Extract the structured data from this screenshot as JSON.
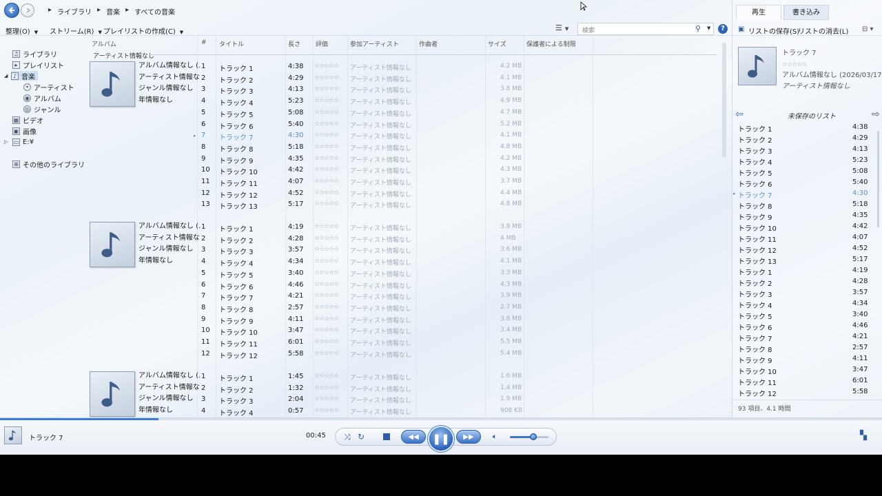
{
  "breadcrumb": [
    "ライブラリ",
    "音楽",
    "すべての音楽"
  ],
  "menu": {
    "organize": "整理(O)",
    "stream": "ストリーム(R)",
    "create_playlist": "プレイリストの作成(C)"
  },
  "search": {
    "placeholder": "検索"
  },
  "nav": {
    "library": "ライブラリ",
    "playlist": "プレイリスト",
    "music": "音楽",
    "artist": "アーティスト",
    "album": "アルバム",
    "genre": "ジャンル",
    "video": "ビデオ",
    "pictures": "画像",
    "drive": "E:¥",
    "other_libraries": "その他のライブラリ"
  },
  "columns": {
    "album": "アルバム",
    "num": "#",
    "title": "タイトル",
    "length": "長さ",
    "rating": "評価",
    "contributing_artist": "参加アーティスト",
    "composer": "作曲者",
    "size": "サイズ",
    "parental_rating": "保護者による制限"
  },
  "group_label": "アーティスト情報なし",
  "rating_stars": "☆☆☆☆☆",
  "artist_unknown": "アーティスト情報なし",
  "albums": [
    {
      "info": [
        "アルバム情報なし (...",
        "アーティスト情報なし",
        "ジャンル情報なし",
        "年情報なし"
      ],
      "tracks": [
        {
          "num": "1",
          "title": "トラック 1",
          "length": "4:38",
          "size": "4.2 MB"
        },
        {
          "num": "2",
          "title": "トラック 2",
          "length": "4:29",
          "size": "4.1 MB"
        },
        {
          "num": "3",
          "title": "トラック 3",
          "length": "4:13",
          "size": "3.8 MB"
        },
        {
          "num": "4",
          "title": "トラック 4",
          "length": "5:23",
          "size": "4.9 MB"
        },
        {
          "num": "5",
          "title": "トラック 5",
          "length": "5:08",
          "size": "4.7 MB"
        },
        {
          "num": "6",
          "title": "トラック 6",
          "length": "5:40",
          "size": "5.2 MB"
        },
        {
          "num": "7",
          "title": "トラック 7",
          "length": "4:30",
          "size": "4.1 MB",
          "playing": true
        },
        {
          "num": "8",
          "title": "トラック 8",
          "length": "5:18",
          "size": "4.8 MB"
        },
        {
          "num": "9",
          "title": "トラック 9",
          "length": "4:35",
          "size": "4.2 MB"
        },
        {
          "num": "10",
          "title": "トラック 10",
          "length": "4:42",
          "size": "4.3 MB"
        },
        {
          "num": "11",
          "title": "トラック 11",
          "length": "4:07",
          "size": "3.7 MB"
        },
        {
          "num": "12",
          "title": "トラック 12",
          "length": "4:52",
          "size": "4.4 MB"
        },
        {
          "num": "13",
          "title": "トラック 13",
          "length": "5:17",
          "size": "4.8 MB"
        }
      ]
    },
    {
      "info": [
        "アルバム情報なし (...",
        "アーティスト情報なし",
        "ジャンル情報なし",
        "年情報なし"
      ],
      "tracks": [
        {
          "num": "1",
          "title": "トラック 1",
          "length": "4:19",
          "size": "3.9 MB"
        },
        {
          "num": "2",
          "title": "トラック 2",
          "length": "4:28",
          "size": "4 MB"
        },
        {
          "num": "3",
          "title": "トラック 3",
          "length": "3:57",
          "size": "3.6 MB"
        },
        {
          "num": "4",
          "title": "トラック 4",
          "length": "4:34",
          "size": "4.1 MB"
        },
        {
          "num": "5",
          "title": "トラック 5",
          "length": "3:40",
          "size": "3.3 MB"
        },
        {
          "num": "6",
          "title": "トラック 6",
          "length": "4:46",
          "size": "4.3 MB"
        },
        {
          "num": "7",
          "title": "トラック 7",
          "length": "4:21",
          "size": "3.9 MB"
        },
        {
          "num": "8",
          "title": "トラック 8",
          "length": "2:57",
          "size": "2.7 MB"
        },
        {
          "num": "9",
          "title": "トラック 9",
          "length": "4:11",
          "size": "3.8 MB"
        },
        {
          "num": "10",
          "title": "トラック 10",
          "length": "3:47",
          "size": "3.4 MB"
        },
        {
          "num": "11",
          "title": "トラック 11",
          "length": "6:01",
          "size": "5.5 MB"
        },
        {
          "num": "12",
          "title": "トラック 12",
          "length": "5:58",
          "size": "5.4 MB"
        }
      ]
    },
    {
      "info": [
        "アルバム情報なし (...",
        "アーティスト情報なし",
        "ジャンル情報なし",
        "年情報なし"
      ],
      "tracks": [
        {
          "num": "1",
          "title": "トラック 1",
          "length": "1:45",
          "size": "1.6 MB"
        },
        {
          "num": "2",
          "title": "トラック 2",
          "length": "1:32",
          "size": "1.4 MB"
        },
        {
          "num": "3",
          "title": "トラック 3",
          "length": "2:04",
          "size": "1.9 MB"
        },
        {
          "num": "4",
          "title": "トラック 4",
          "length": "0:57",
          "size": "908 KB"
        }
      ]
    }
  ],
  "right_panel": {
    "tab_play": "再生",
    "tab_burn": "書き込み",
    "save_list": "リストの保存(S)",
    "clear_list": "リストの消去(L)",
    "now_playing": {
      "title": "トラック 7",
      "stars": "☆☆☆☆☆",
      "album": "アルバム情報なし (2026/03/17 21:...",
      "artist": "アーティスト情報なし"
    },
    "list_title": "未保存のリスト",
    "playlist": [
      {
        "title": "トラック 1",
        "length": "4:38"
      },
      {
        "title": "トラック 2",
        "length": "4:29"
      },
      {
        "title": "トラック 3",
        "length": "4:13"
      },
      {
        "title": "トラック 4",
        "length": "5:23"
      },
      {
        "title": "トラック 5",
        "length": "5:08"
      },
      {
        "title": "トラック 6",
        "length": "5:40"
      },
      {
        "title": "トラック 7",
        "length": "4:30",
        "playing": true
      },
      {
        "title": "トラック 8",
        "length": "5:18"
      },
      {
        "title": "トラック 9",
        "length": "4:35"
      },
      {
        "title": "トラック 10",
        "length": "4:42"
      },
      {
        "title": "トラック 11",
        "length": "4:07"
      },
      {
        "title": "トラック 12",
        "length": "4:52"
      },
      {
        "title": "トラック 13",
        "length": "5:17"
      },
      {
        "title": "トラック 1",
        "length": "4:19"
      },
      {
        "title": "トラック 2",
        "length": "4:28"
      },
      {
        "title": "トラック 3",
        "length": "3:57"
      },
      {
        "title": "トラック 4",
        "length": "4:34"
      },
      {
        "title": "トラック 5",
        "length": "3:40"
      },
      {
        "title": "トラック 6",
        "length": "4:46"
      },
      {
        "title": "トラック 7",
        "length": "4:21"
      },
      {
        "title": "トラック 8",
        "length": "2:57"
      },
      {
        "title": "トラック 9",
        "length": "4:11"
      },
      {
        "title": "トラック 10",
        "length": "3:47"
      },
      {
        "title": "トラック 11",
        "length": "6:01"
      },
      {
        "title": "トラック 12",
        "length": "5:58"
      }
    ],
    "footer": "93 項目、4.1 時間"
  },
  "player": {
    "now_playing_title": "トラック 7",
    "elapsed": "00:45",
    "seek_progress": 0.18,
    "volume": 0.6
  },
  "colors": {
    "accent": "#2e5fa6",
    "playing": "#5a8fd0"
  }
}
